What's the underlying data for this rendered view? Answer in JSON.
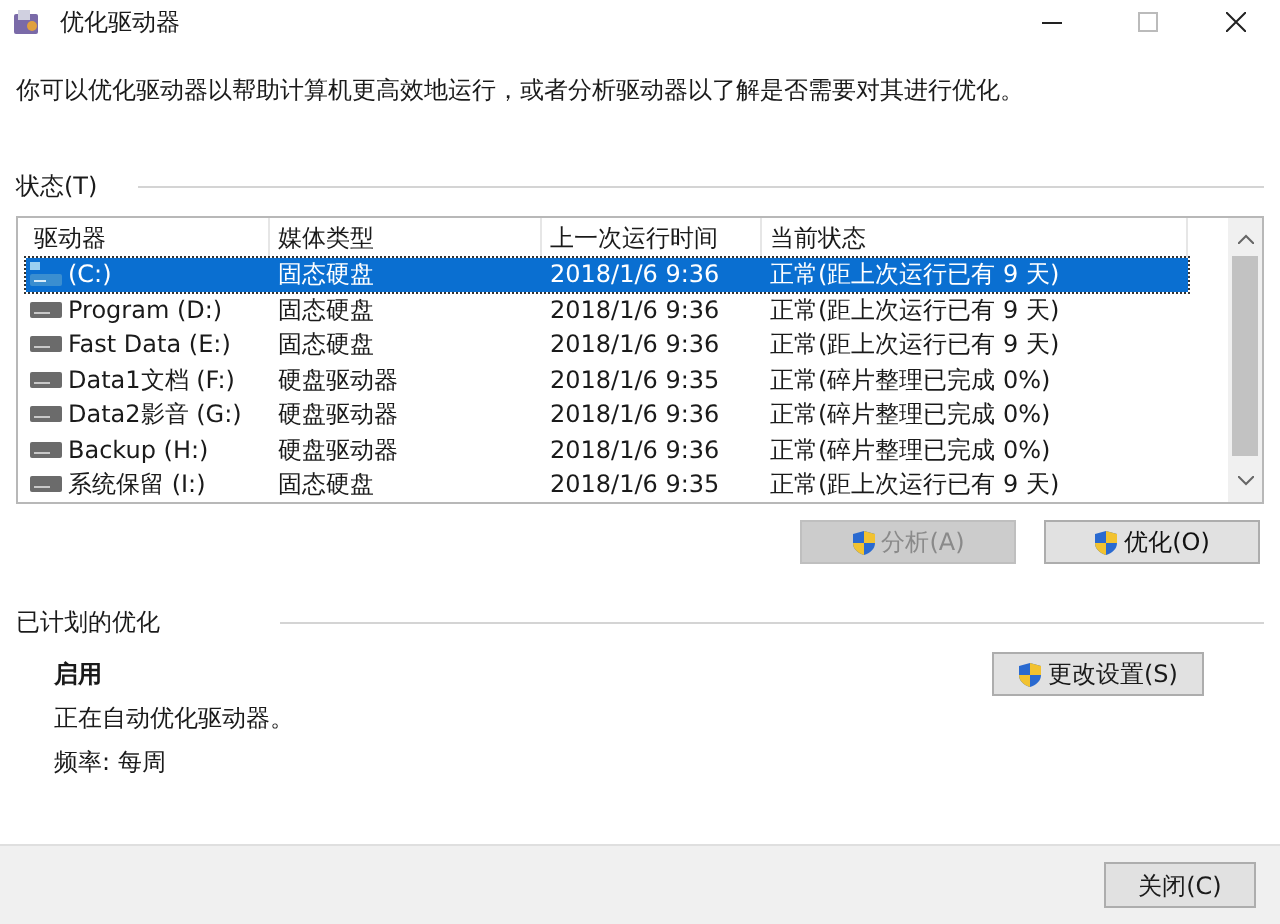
{
  "window": {
    "title": "优化驱动器"
  },
  "description": "你可以优化驱动器以帮助计算机更高效地运行，或者分析驱动器以了解是否需要对其进行优化。",
  "status": {
    "label": "状态(T)",
    "table": {
      "columns": [
        "驱动器",
        "媒体类型",
        "上一次运行时间",
        "当前状态"
      ],
      "rows": [
        {
          "drive": "(C:)",
          "kind": "system",
          "media": "固态硬盘",
          "last_run": "2018/1/6 9:36",
          "state": "正常(距上次运行已有 9 天)",
          "selected": true
        },
        {
          "drive": "Program (D:)",
          "kind": "disk",
          "media": "固态硬盘",
          "last_run": "2018/1/6 9:36",
          "state": "正常(距上次运行已有 9 天)",
          "selected": false
        },
        {
          "drive": "Fast Data (E:)",
          "kind": "disk",
          "media": "固态硬盘",
          "last_run": "2018/1/6 9:36",
          "state": "正常(距上次运行已有 9 天)",
          "selected": false
        },
        {
          "drive": "Data1文档 (F:)",
          "kind": "disk",
          "media": "硬盘驱动器",
          "last_run": "2018/1/6 9:35",
          "state": "正常(碎片整理已完成 0%)",
          "selected": false
        },
        {
          "drive": "Data2影音 (G:)",
          "kind": "disk",
          "media": "硬盘驱动器",
          "last_run": "2018/1/6 9:36",
          "state": "正常(碎片整理已完成 0%)",
          "selected": false
        },
        {
          "drive": "Backup (H:)",
          "kind": "disk",
          "media": "硬盘驱动器",
          "last_run": "2018/1/6 9:36",
          "state": "正常(碎片整理已完成 0%)",
          "selected": false
        },
        {
          "drive": "系统保留 (I:)",
          "kind": "disk",
          "media": "固态硬盘",
          "last_run": "2018/1/6 9:35",
          "state": "正常(距上次运行已有 9 天)",
          "selected": false
        }
      ]
    },
    "buttons": [
      {
        "label": "分析(A)",
        "disabled": true
      },
      {
        "label": "优化(O)",
        "disabled": false
      }
    ]
  },
  "scheduled": {
    "label": "已计划的优化",
    "status": "启用",
    "detail": "正在自动优化驱动器。",
    "frequency": "频率: 每周",
    "button": "更改设置(S)"
  },
  "close_button": "关闭(C)"
}
